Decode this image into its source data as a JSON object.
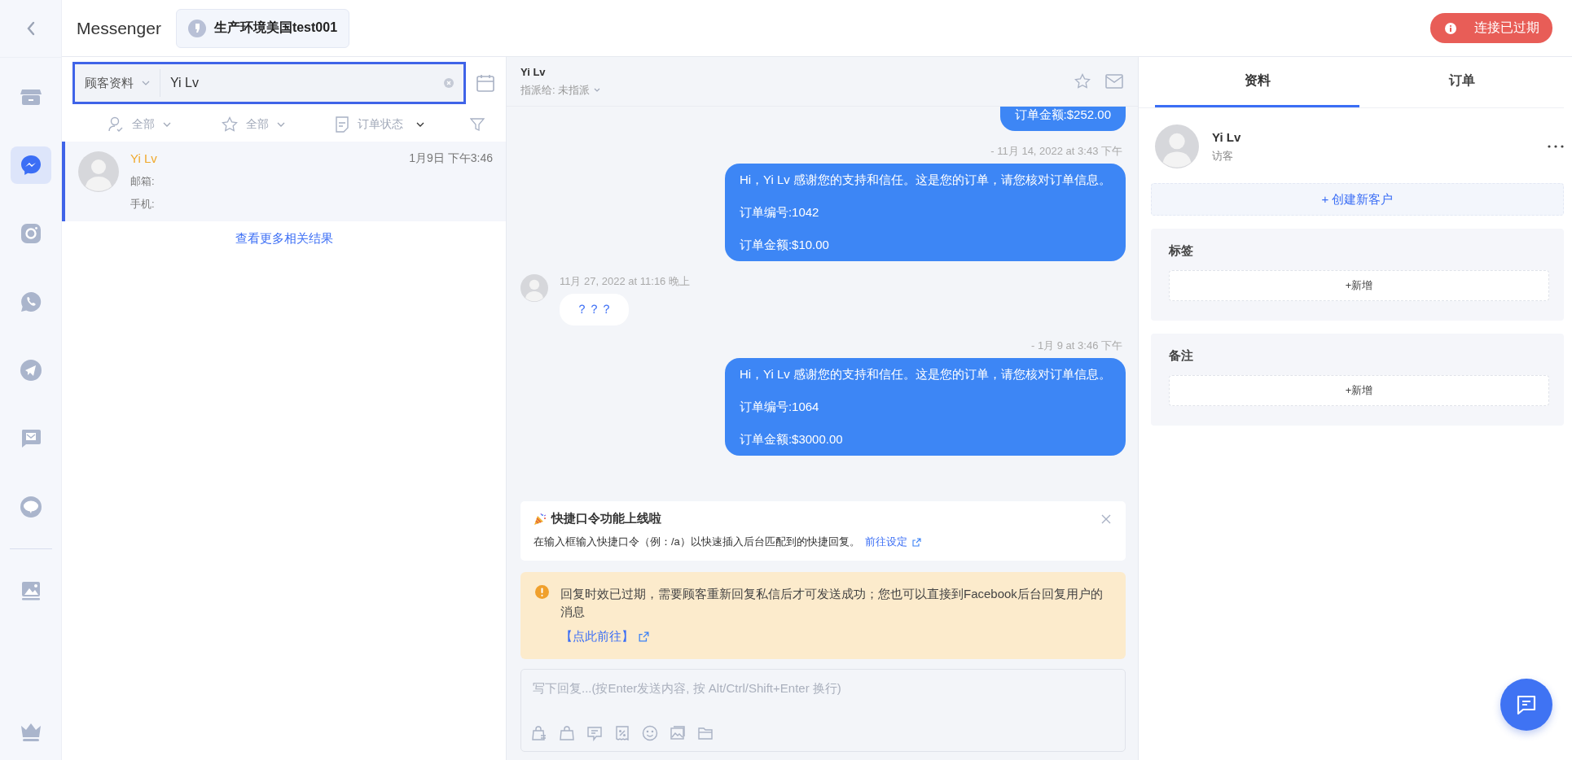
{
  "header": {
    "title": "Messenger",
    "shop": "生产环境美国test001",
    "status": "连接已过期"
  },
  "rail": [
    {
      "kind": "store",
      "selected": false
    },
    {
      "kind": "messenger",
      "selected": true
    },
    {
      "kind": "instagram",
      "selected": false
    },
    {
      "kind": "whatsapp",
      "selected": false
    },
    {
      "kind": "telegram",
      "selected": false
    },
    {
      "kind": "sms",
      "selected": false
    },
    {
      "kind": "line",
      "selected": false
    },
    {
      "kind": "divider"
    },
    {
      "kind": "gallery",
      "selected": false
    },
    {
      "kind": "crown",
      "selected": false
    }
  ],
  "search": {
    "scope": "顾客资料",
    "value": "Yi Lv"
  },
  "filters": [
    {
      "kind": "agent",
      "label": "全部"
    },
    {
      "kind": "star",
      "label": "全部"
    },
    {
      "kind": "order",
      "label": "订单状态"
    }
  ],
  "results": [
    {
      "name": "Yi Lv",
      "time": "1月9日 下午3:46",
      "lines": [
        "邮箱:",
        "手机:"
      ],
      "selected": true
    }
  ],
  "more_results": "查看更多相关结果",
  "chat": {
    "name": "Yi Lv",
    "assign_label": "指派给:",
    "assignee": "未指派",
    "messages": [
      {
        "kind": "outgoing",
        "continued": true,
        "lines": [
          "订单金额:$252.00"
        ]
      },
      {
        "kind": "outgoing",
        "continued": false,
        "time": "- 11月 14, 2022 at 3:43 下午",
        "lines": [
          "Hi，Yi Lv 感谢您的支持和信任。这是您的订单，请您核对订单信息。",
          "订单编号:1042",
          "订单金额:$10.00"
        ]
      },
      {
        "kind": "incoming",
        "continued": false,
        "time": "11月 27, 2022 at 11:16 晚上",
        "lines": [
          "？？？"
        ]
      },
      {
        "kind": "outgoing",
        "continued": false,
        "time": "- 1月 9 at 3:46 下午",
        "lines": [
          "Hi，Yi Lv 感谢您的支持和信任。这是您的订单，请您核对订单信息。",
          "订单编号:1064",
          "订单金额:$3000.00"
        ]
      }
    ],
    "notice": {
      "title": "快捷口令功能上线啦",
      "text": "在输入框输入快捷口令（例：/a）以快速插入后台匹配到的快捷回复。",
      "link": "前往设定"
    },
    "warning": {
      "text": "回复时效已过期，需要顾客重新回复私信后才可发送成功；您也可以直接到Facebook后台回复用户的消息",
      "link": "【点此前往】"
    },
    "composer": {
      "placeholder": "写下回复...(按Enter发送内容, 按 Alt/Ctrl/Shift+Enter 换行)",
      "tools": [
        {
          "kind": "product"
        },
        {
          "kind": "bag"
        },
        {
          "kind": "note"
        },
        {
          "kind": "coupon"
        },
        {
          "kind": "emoji"
        },
        {
          "kind": "image"
        },
        {
          "kind": "folder"
        }
      ]
    }
  },
  "details": {
    "tabs": [
      {
        "label": "资料",
        "selected": true
      },
      {
        "label": "订单",
        "selected": false
      }
    ],
    "profile": {
      "name": "Yi Lv",
      "role": "访客"
    },
    "create": "+ 创建新客户",
    "sections": [
      {
        "title": "标签",
        "add": "+新增"
      },
      {
        "title": "备注",
        "add": "+新增"
      }
    ]
  }
}
